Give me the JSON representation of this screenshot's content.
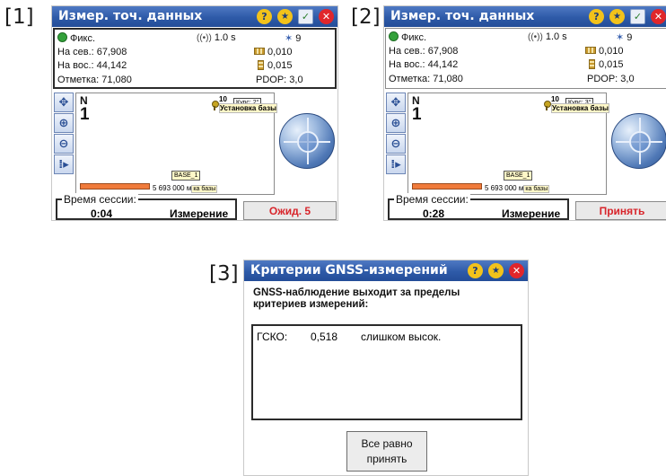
{
  "markers": [
    "[1]",
    "[2]",
    "[3]"
  ],
  "screens": [
    {
      "title": "Измер. точ. данных",
      "fix": "Фикс.",
      "interval": "1.0 s",
      "satellites": "9",
      "north_label": "На сев.:",
      "north_value": "67,908",
      "east_label": "На вос.:",
      "east_value": "44,142",
      "elev_label": "Отметка:",
      "elev_value": "71,080",
      "h_precision": "0,010",
      "v_precision": "0,015",
      "pdop": "PDOP: 3,0",
      "map_north": "N",
      "map_number": "1",
      "pin_number": "10",
      "course": "Курс: 2°",
      "base_setup": "Установка базы",
      "base_label": "BASE_1",
      "scale": "5 693 000 м",
      "scale_suffix": "ка базы",
      "session_label": "Время сессии:",
      "session_time": "0:04",
      "mode": "Измерение",
      "action": "Ожид. 5"
    },
    {
      "title": "Измер. точ. данных",
      "fix": "Фикс.",
      "interval": "1.0 s",
      "satellites": "9",
      "north_label": "На сев.:",
      "north_value": "67,908",
      "east_label": "На вос.:",
      "east_value": "44,142",
      "elev_label": "Отметка:",
      "elev_value": "71,080",
      "h_precision": "0,010",
      "v_precision": "0,015",
      "pdop": "PDOP: 3,0",
      "map_north": "N",
      "map_number": "1",
      "pin_number": "10",
      "course": "Курс: 3°",
      "base_setup": "Установка базы",
      "base_label": "BASE_1",
      "scale": "5 693 000 м",
      "scale_suffix": "ка базы",
      "session_label": "Время сессии:",
      "session_time": "0:28",
      "mode": "Измерение",
      "action": "Принять"
    }
  ],
  "dialog": {
    "title": "Критерии GNSS-измерений",
    "message_line1": "GNSS-наблюдение выходит за пределы",
    "message_line2": "критериев измерений:",
    "row_key": "ГСКО:",
    "row_value": "0,518",
    "row_status": "слишком высок.",
    "accept_line1": "Все равно",
    "accept_line2": "принять"
  },
  "icons": {
    "help": "help-icon",
    "favorite": "star-icon",
    "check": "check-icon",
    "close": "close-icon"
  },
  "colors": {
    "title_bar": "#2e5aa8",
    "accent_red": "#d8252b",
    "fix_green": "#33a13a",
    "scale_orange": "#f07b3b"
  }
}
